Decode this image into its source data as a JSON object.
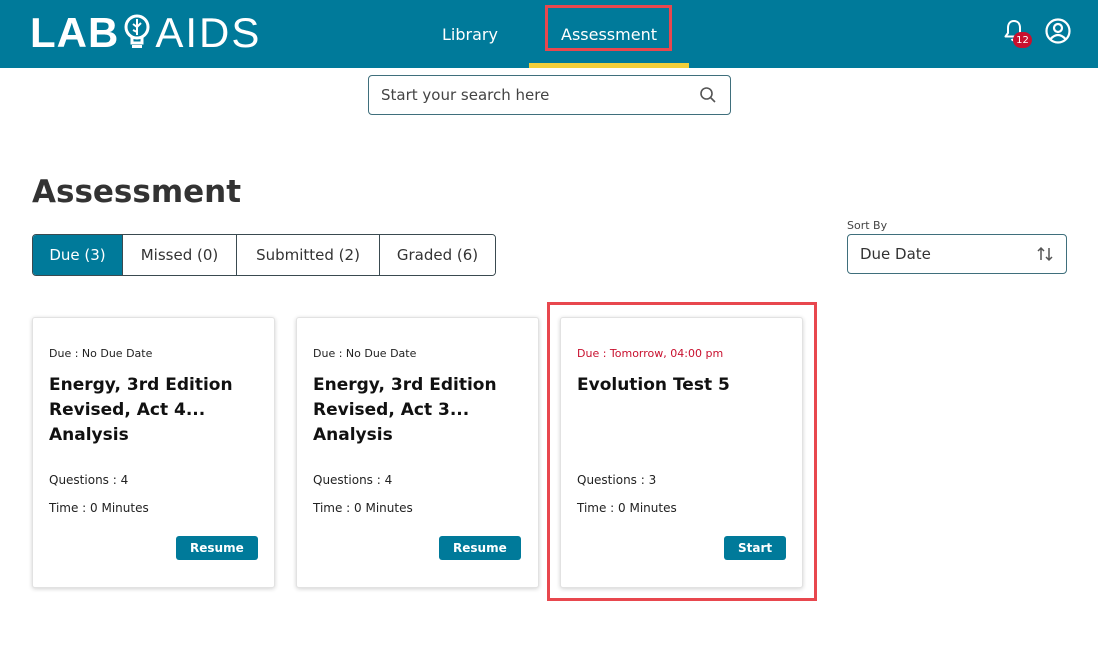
{
  "header": {
    "logo_left": "LAB",
    "logo_right": "AIDS",
    "nav": [
      {
        "label": "Library"
      },
      {
        "label": "Assessment"
      }
    ],
    "notification_count": "12"
  },
  "search": {
    "placeholder": "Start your search here"
  },
  "page": {
    "title": "Assessment"
  },
  "tabs": [
    {
      "label": "Due (3)",
      "active": true
    },
    {
      "label": "Missed (0)"
    },
    {
      "label": "Submitted (2)"
    },
    {
      "label": "Graded (6)"
    }
  ],
  "sort": {
    "label": "Sort By",
    "value": "Due Date"
  },
  "cards": [
    {
      "due": "Due : No Due Date",
      "title": "Energy, 3rd Edition Revised, Act 4... Analysis",
      "questions": "Questions : 4",
      "time": "Time : 0 Minutes",
      "button": "Resume"
    },
    {
      "due": "Due : No Due Date",
      "title": "Energy, 3rd Edition Revised, Act 3... Analysis",
      "questions": "Questions : 4",
      "time": "Time : 0 Minutes",
      "button": "Resume"
    },
    {
      "due": "Due : Tomorrow, 04:00 pm",
      "title": "Evolution Test 5",
      "questions": "Questions : 3",
      "time": "Time : 0 Minutes",
      "button": "Start"
    }
  ],
  "colors": {
    "brand": "#007a9a",
    "accent_underline": "#f2cf3a",
    "highlight": "#e8474e",
    "due_red": "#c8102e"
  }
}
